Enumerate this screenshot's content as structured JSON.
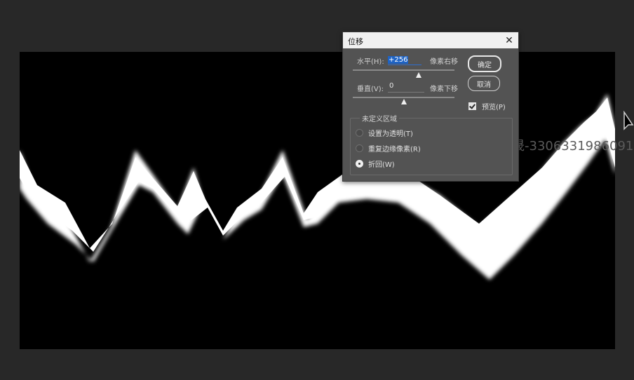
{
  "watermark": "黄晟-3306331986091",
  "dialog": {
    "title": "位移",
    "close_label": "✕",
    "horizontal": {
      "label": "水平(H):",
      "value": "+256",
      "unit": "像素右移",
      "slider_position": 0.65
    },
    "vertical": {
      "label": "垂直(V):",
      "value": "0",
      "unit": "像素下移",
      "slider_position": 0.5
    },
    "ok_label": "确定",
    "cancel_label": "取消",
    "preview_label": "预览(P)",
    "preview_checked": true,
    "undefined_area": {
      "title": "未定义区域",
      "options": [
        {
          "label": "设置为透明(T)",
          "checked": false
        },
        {
          "label": "重复边缘像素(R)",
          "checked": false
        },
        {
          "label": "折回(W)",
          "checked": true
        }
      ]
    }
  },
  "colors": {
    "workspace": "#282828",
    "canvas": "#000000",
    "dialog_bg": "#535353",
    "highlight": "#1e63c4"
  },
  "icons": [
    "close-icon",
    "cursor-arrow-icon",
    "checkbox-checked-icon",
    "radio-icon"
  ]
}
